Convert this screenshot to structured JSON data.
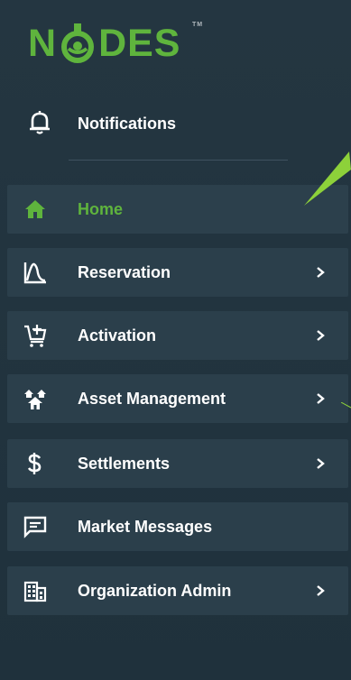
{
  "brand": {
    "logo_text_left": "N",
    "logo_text_right": "DES",
    "tm": "TM",
    "accent": "#5fb43d"
  },
  "notifications": {
    "label": "Notifications",
    "icon": "bell-icon"
  },
  "menu": [
    {
      "label": "Home",
      "icon": "home-icon",
      "active": true,
      "has_chevron": false
    },
    {
      "label": "Reservation",
      "icon": "reservation-icon",
      "active": false,
      "has_chevron": true
    },
    {
      "label": "Activation",
      "icon": "cart-add-icon",
      "active": false,
      "has_chevron": true
    },
    {
      "label": "Asset Management",
      "icon": "houses-icon",
      "active": false,
      "has_chevron": true
    },
    {
      "label": "Settlements",
      "icon": "dollar-icon",
      "active": false,
      "has_chevron": true
    },
    {
      "label": "Market Messages",
      "icon": "message-icon",
      "active": false,
      "has_chevron": false
    },
    {
      "label": "Organization Admin",
      "icon": "building-icon",
      "active": false,
      "has_chevron": true
    }
  ],
  "chevron_glyph": ">"
}
